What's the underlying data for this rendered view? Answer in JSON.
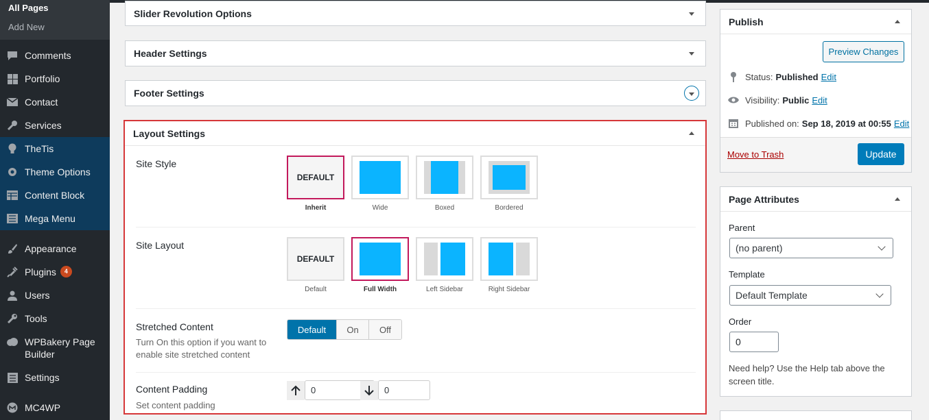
{
  "sidebar": {
    "sub_items": [
      {
        "label": "All Pages"
      },
      {
        "label": "Add New"
      }
    ],
    "items": [
      {
        "label": "Comments",
        "icon": "comment-icon"
      },
      {
        "label": "Portfolio",
        "icon": "grid-icon"
      },
      {
        "label": "Contact",
        "icon": "mail-icon"
      },
      {
        "label": "Services",
        "icon": "wrench-icon"
      },
      {
        "label": "TheTis",
        "icon": "bulb-icon"
      },
      {
        "label": "Theme Options",
        "icon": "gear-icon"
      },
      {
        "label": "Content Block",
        "icon": "table-icon"
      },
      {
        "label": "Mega Menu",
        "icon": "list-icon"
      },
      {
        "label": "Appearance",
        "icon": "brush-icon"
      },
      {
        "label": "Plugins",
        "icon": "plug-icon",
        "badge": "4"
      },
      {
        "label": "Users",
        "icon": "user-icon"
      },
      {
        "label": "Tools",
        "icon": "tools-icon"
      },
      {
        "label": "WPBakery Page Builder",
        "icon": "cloud-icon"
      },
      {
        "label": "Settings",
        "icon": "settings-icon"
      },
      {
        "label": "MC4WP",
        "icon": "mc4wp-icon"
      }
    ]
  },
  "panels": {
    "slider": "Slider Revolution Options",
    "header": "Header Settings",
    "footer": "Footer Settings",
    "layout": "Layout Settings"
  },
  "layout": {
    "site_style": {
      "label": "Site Style",
      "options": [
        "Inherit",
        "Wide",
        "Boxed",
        "Bordered"
      ],
      "default_text": "DEFAULT",
      "selected": "Inherit"
    },
    "site_layout": {
      "label": "Site Layout",
      "options": [
        "Default",
        "Full Width",
        "Left Sidebar",
        "Right Sidebar"
      ],
      "default_text": "DEFAULT",
      "selected": "Full Width"
    },
    "stretched": {
      "label": "Stretched Content",
      "desc_line1": "Turn On this option if you want to",
      "desc_line2": "enable site stretched content",
      "options": [
        "Default",
        "On",
        "Off"
      ],
      "selected": "Default"
    },
    "padding": {
      "label": "Content Padding",
      "desc": "Set content padding",
      "top": "0",
      "bottom": "0"
    }
  },
  "publish": {
    "title": "Publish",
    "preview": "Preview Changes",
    "status_label": "Status:",
    "status_value": "Published",
    "visibility_label": "Visibility:",
    "visibility_value": "Public",
    "published_label": "Published on:",
    "published_value": "Sep 18, 2019 at 00:55",
    "edit": "Edit",
    "trash": "Move to Trash",
    "update": "Update"
  },
  "attributes": {
    "title": "Page Attributes",
    "parent_label": "Parent",
    "parent_value": "(no parent)",
    "template_label": "Template",
    "template_value": "Default Template",
    "order_label": "Order",
    "order_value": "0",
    "help_line1": "Need help? Use the Help tab above the",
    "help_line2": "screen title."
  },
  "colors": {
    "accent": "#0073aa",
    "highlight_border": "#d63638",
    "selected_option": "#c2185b",
    "preview_blue": "#0bb4ff"
  }
}
